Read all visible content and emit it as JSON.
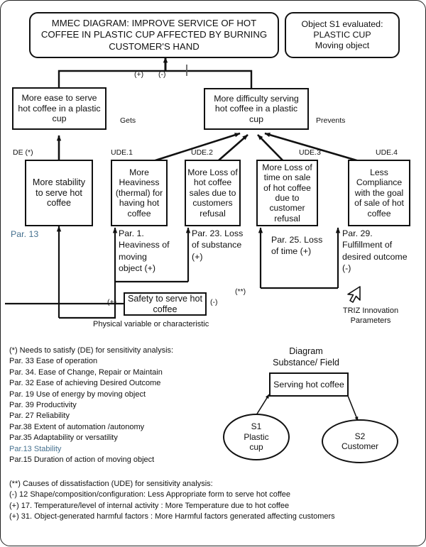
{
  "header": {
    "title": "MMEC DIAGRAM: IMPROVE SERVICE OF HOT COFFEE IN PLASTIC CUP AFFECTED BY BURNING CUSTOMER'S HAND",
    "object_box": "Object S1 evaluated: PLASTIC CUP Moving object",
    "object_box_line1": "Object S1 evaluated:",
    "object_box_line2": "PLASTIC CUP",
    "object_box_line3": "Moving object"
  },
  "effects": {
    "plus_label": "(+)",
    "minus_label": "(-)",
    "ease_box": "More ease to serve hot coffee in a plastic cup",
    "difficulty_box": "More difficulty serving hot coffee in a plastic cup",
    "gets_label": "Gets",
    "prevents_label": "Prevents"
  },
  "columns": [
    {
      "tag": "DE (*)",
      "box": "More stability to serve hot coffee",
      "par": "Par. 13",
      "par_blue": true
    },
    {
      "tag": "UDE.1",
      "box": "More Heaviness (thermal) for having hot coffee",
      "par": "Par. 1. Heaviness of moving object (+)",
      "par_blue": false
    },
    {
      "tag": "UDE.2",
      "box": "More Loss of hot coffee sales due to customers refusal",
      "par": "Par. 23. Loss of substance (+)",
      "par_blue": false
    },
    {
      "tag": "UDE.3",
      "box": "More Loss of time on sale of hot coffee due to customer refusal",
      "par": "Par. 25. Loss of time (+)",
      "par_blue": false
    },
    {
      "tag": "UDE.4",
      "box": "Less Compliance with the goal of sale of hot coffee",
      "par": "Par. 29. Fulfillment of desired outcome (-)",
      "par_blue": false
    }
  ],
  "safety": {
    "box": "Safety to serve hot coffee",
    "plus_label": "(+)",
    "minus_label": "(-)",
    "starstar_label": "(**)",
    "caption": "Physical variable or characteristic"
  },
  "triz": {
    "icon": "cursor-arrow-icon",
    "line1": "TRIZ Innovation",
    "line2": "Parameters"
  },
  "notes_de": {
    "heading": "(*) Needs to satisfy (DE) for sensitivity analysis:",
    "items": [
      "Par. 33 Ease of operation",
      "Par. 34. Ease of Change, Repair or Maintain",
      "Par. 32 Ease of achieving Desired Outcome",
      "Par. 19 Use of energy by moving object",
      "Par. 39 Productivity",
      "Par. 27  Reliability",
      "Par.38 Extent of automation /autonomy",
      "Par.35  Adaptability or versatility",
      "Par.13 Stability",
      "Par.15 Duration of action of moving object"
    ],
    "blue_index": 8
  },
  "notes_ude": {
    "heading": "(**) Causes of dissatisfaction (UDE) for sensitivity analysis:",
    "items": [
      "(-) 12 Shape/composition/configuration:  Less Appropriate form to serve hot coffee",
      "(+) 17. Temperature/level of internal activity : More Temperature due to hot coffee",
      "(+) 31. Object-generated harmful factors : More Harmful factors generated affecting customers"
    ]
  },
  "sufield": {
    "title_line1": "Diagram",
    "title_line2": "Substance/ Field",
    "field_box": "Serving hot coffee",
    "s1_line1": "S1",
    "s1_line2": "Plastic",
    "s1_line3": "cup",
    "s2_line1": "S2",
    "s2_line2": "Customer"
  },
  "colors": {
    "ink": "#111111",
    "blue": "#46718f",
    "paper": "#ffffff"
  }
}
